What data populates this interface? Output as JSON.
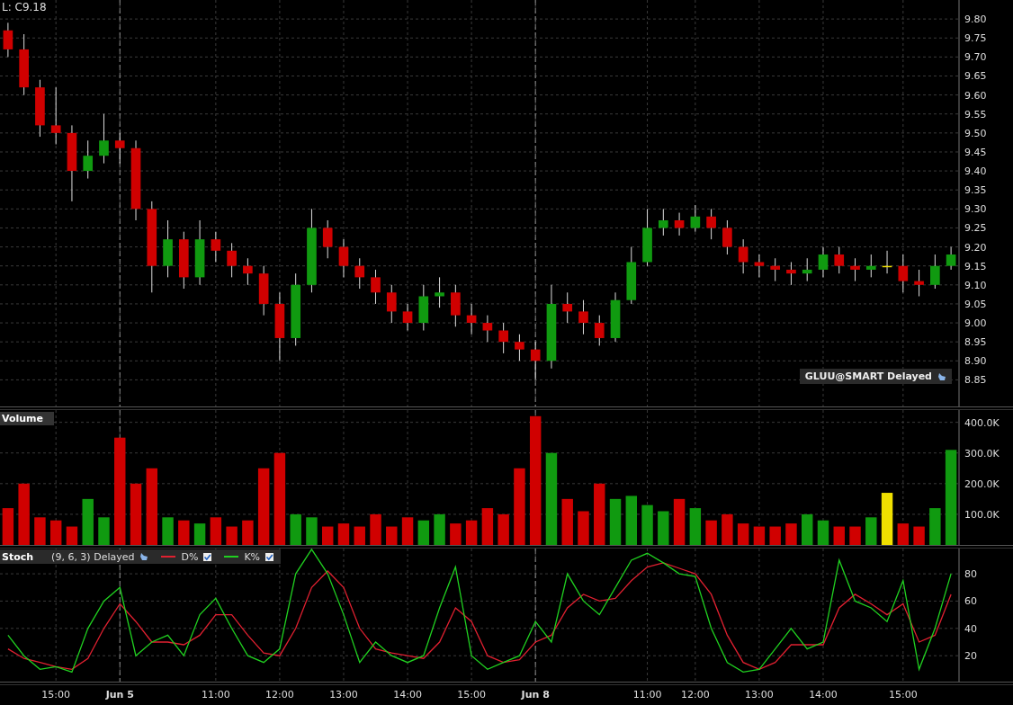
{
  "quote_label": "L: C9.18",
  "price_panel": {
    "badge": "GLUU@SMART Delayed",
    "chart_data": {
      "type": "candlestick",
      "grid": true,
      "ylim": [
        8.78,
        9.85
      ],
      "yticks": [
        {
          "value": 8.85,
          "label": "8.85"
        },
        {
          "value": 8.9,
          "label": "8.90"
        },
        {
          "value": 8.95,
          "label": "8.95"
        },
        {
          "value": 9.0,
          "label": "9.00"
        },
        {
          "value": 9.05,
          "label": "9.05"
        },
        {
          "value": 9.1,
          "label": "9.10"
        },
        {
          "value": 9.15,
          "label": "9.15"
        },
        {
          "value": 9.2,
          "label": "9.20"
        },
        {
          "value": 9.25,
          "label": "9.25"
        },
        {
          "value": 9.3,
          "label": "9.30"
        },
        {
          "value": 9.35,
          "label": "9.35"
        },
        {
          "value": 9.4,
          "label": "9.40"
        },
        {
          "value": 9.45,
          "label": "9.45"
        },
        {
          "value": 9.5,
          "label": "9.50"
        },
        {
          "value": 9.55,
          "label": "9.55"
        },
        {
          "value": 9.6,
          "label": "9.60"
        },
        {
          "value": 9.65,
          "label": "9.65"
        },
        {
          "value": 9.7,
          "label": "9.70"
        },
        {
          "value": 9.75,
          "label": "9.75"
        },
        {
          "value": 9.8,
          "label": "9.80"
        }
      ],
      "ohlc": [
        [
          9.77,
          9.79,
          9.7,
          9.72
        ],
        [
          9.72,
          9.76,
          9.6,
          9.62
        ],
        [
          9.62,
          9.64,
          9.49,
          9.52
        ],
        [
          9.52,
          9.62,
          9.47,
          9.5
        ],
        [
          9.5,
          9.52,
          9.32,
          9.4
        ],
        [
          9.4,
          9.48,
          9.38,
          9.44
        ],
        [
          9.44,
          9.55,
          9.42,
          9.48
        ],
        [
          9.48,
          9.5,
          9.42,
          9.46
        ],
        [
          9.46,
          9.48,
          9.27,
          9.3
        ],
        [
          9.3,
          9.32,
          9.08,
          9.15
        ],
        [
          9.15,
          9.27,
          9.12,
          9.22
        ],
        [
          9.22,
          9.24,
          9.09,
          9.12
        ],
        [
          9.12,
          9.27,
          9.1,
          9.22
        ],
        [
          9.22,
          9.24,
          9.16,
          9.19
        ],
        [
          9.19,
          9.21,
          9.12,
          9.15
        ],
        [
          9.15,
          9.17,
          9.1,
          9.13
        ],
        [
          9.13,
          9.15,
          9.02,
          9.05
        ],
        [
          9.05,
          9.08,
          8.9,
          8.96
        ],
        [
          8.96,
          9.13,
          8.94,
          9.1
        ],
        [
          9.1,
          9.3,
          9.08,
          9.25
        ],
        [
          9.25,
          9.27,
          9.17,
          9.2
        ],
        [
          9.2,
          9.22,
          9.12,
          9.15
        ],
        [
          9.15,
          9.17,
          9.09,
          9.12
        ],
        [
          9.12,
          9.14,
          9.05,
          9.08
        ],
        [
          9.08,
          9.1,
          9.0,
          9.03
        ],
        [
          9.03,
          9.05,
          8.98,
          9.0
        ],
        [
          9.0,
          9.1,
          8.98,
          9.07
        ],
        [
          9.07,
          9.12,
          9.04,
          9.08
        ],
        [
          9.08,
          9.1,
          8.99,
          9.02
        ],
        [
          9.02,
          9.05,
          8.97,
          9.0
        ],
        [
          9.0,
          9.02,
          8.95,
          8.98
        ],
        [
          8.98,
          9.0,
          8.92,
          8.95
        ],
        [
          8.95,
          8.97,
          8.9,
          8.93
        ],
        [
          8.93,
          8.95,
          8.85,
          8.9
        ],
        [
          8.9,
          9.1,
          8.88,
          9.05
        ],
        [
          9.05,
          9.08,
          9.0,
          9.03
        ],
        [
          9.03,
          9.06,
          8.97,
          9.0
        ],
        [
          9.0,
          9.02,
          8.94,
          8.96
        ],
        [
          8.96,
          9.08,
          8.95,
          9.06
        ],
        [
          9.06,
          9.2,
          9.05,
          9.16
        ],
        [
          9.16,
          9.3,
          9.15,
          9.25
        ],
        [
          9.25,
          9.3,
          9.23,
          9.27
        ],
        [
          9.27,
          9.29,
          9.23,
          9.25
        ],
        [
          9.25,
          9.31,
          9.24,
          9.28
        ],
        [
          9.28,
          9.3,
          9.22,
          9.25
        ],
        [
          9.25,
          9.27,
          9.18,
          9.2
        ],
        [
          9.2,
          9.22,
          9.13,
          9.16
        ],
        [
          9.16,
          9.18,
          9.12,
          9.15
        ],
        [
          9.15,
          9.17,
          9.11,
          9.14
        ],
        [
          9.14,
          9.16,
          9.1,
          9.13
        ],
        [
          9.13,
          9.17,
          9.11,
          9.14
        ],
        [
          9.14,
          9.2,
          9.12,
          9.18
        ],
        [
          9.18,
          9.2,
          9.13,
          9.15
        ],
        [
          9.15,
          9.17,
          9.11,
          9.14
        ],
        [
          9.14,
          9.18,
          9.12,
          9.15
        ],
        [
          9.15,
          9.19,
          9.13,
          9.15
        ],
        [
          9.15,
          9.18,
          9.08,
          9.11
        ],
        [
          9.11,
          9.14,
          9.07,
          9.1
        ],
        [
          9.1,
          9.18,
          9.09,
          9.15
        ],
        [
          9.15,
          9.2,
          9.14,
          9.18
        ]
      ]
    }
  },
  "volume_panel": {
    "chart_data": {
      "type": "bar",
      "grid": true,
      "ylim": [
        0,
        440000
      ],
      "yticks": [
        {
          "value": 100000,
          "label": "100.0K"
        },
        {
          "value": 200000,
          "label": "200.0K"
        },
        {
          "value": 300000,
          "label": "300.0K"
        },
        {
          "value": 400000,
          "label": "400.0K"
        }
      ],
      "series": [
        {
          "name": "Volume",
          "values": [
            120000,
            200000,
            90000,
            80000,
            60000,
            150000,
            90000,
            350000,
            200000,
            250000,
            90000,
            80000,
            70000,
            90000,
            60000,
            80000,
            250000,
            300000,
            100000,
            90000,
            60000,
            70000,
            60000,
            100000,
            60000,
            90000,
            80000,
            100000,
            70000,
            80000,
            120000,
            100000,
            250000,
            420000,
            300000,
            150000,
            110000,
            200000,
            150000,
            160000,
            130000,
            110000,
            150000,
            120000,
            80000,
            100000,
            70000,
            60000,
            60000,
            70000,
            100000,
            80000,
            60000,
            60000,
            90000,
            170000,
            70000,
            60000,
            120000,
            310000
          ]
        }
      ]
    }
  },
  "stoch_panel": {
    "title": "Stoch",
    "params": "(9, 6, 3) Delayed",
    "series_toggles": [
      {
        "checked": true
      },
      {
        "checked": true
      }
    ],
    "chart_data": {
      "type": "line",
      "grid": true,
      "legend": "top-left",
      "ylim": [
        1,
        98.5
      ],
      "categories": [
        null,
        null,
        null,
        "15:00",
        null,
        null,
        null,
        "Jun 5",
        null,
        null,
        null,
        null,
        null,
        "11:00",
        null,
        null,
        null,
        "12:00",
        null,
        null,
        null,
        "13:00",
        null,
        null,
        null,
        "14:00",
        null,
        null,
        null,
        "15:00",
        null,
        null,
        null,
        "Jun 8",
        null,
        null,
        null,
        null,
        null,
        null,
        "11:00",
        null,
        null,
        "12:00",
        null,
        null,
        null,
        "13:00",
        null,
        null,
        null,
        "14:00",
        null,
        null,
        null,
        null,
        "15:00",
        null,
        null,
        null
      ],
      "yticks": [
        {
          "value": 20,
          "label": "20"
        },
        {
          "value": 40,
          "label": "40"
        },
        {
          "value": 60,
          "label": "60"
        },
        {
          "value": 80,
          "label": "80"
        }
      ],
      "series": [
        {
          "name": "D%",
          "color": "#e02030",
          "values": [
            25,
            18,
            15,
            12,
            10,
            18,
            40,
            58,
            45,
            30,
            30,
            28,
            35,
            50,
            50,
            35,
            22,
            20,
            40,
            70,
            82,
            70,
            40,
            25,
            22,
            20,
            18,
            30,
            55,
            45,
            20,
            15,
            17,
            30,
            35,
            55,
            65,
            60,
            62,
            75,
            85,
            88,
            84,
            80,
            65,
            35,
            15,
            10,
            15,
            28,
            28,
            28,
            55,
            65,
            58,
            50,
            58,
            30,
            35,
            65
          ]
        },
        {
          "name": "K%",
          "color": "#20d020",
          "values": [
            35,
            20,
            10,
            12,
            8,
            40,
            60,
            70,
            20,
            30,
            35,
            20,
            50,
            62,
            40,
            20,
            15,
            25,
            80,
            98,
            80,
            50,
            15,
            30,
            20,
            15,
            20,
            55,
            85,
            20,
            10,
            15,
            20,
            45,
            30,
            80,
            60,
            50,
            70,
            90,
            95,
            88,
            80,
            78,
            40,
            15,
            8,
            10,
            25,
            40,
            25,
            30,
            90,
            60,
            55,
            45,
            75,
            10,
            40,
            80
          ]
        }
      ]
    }
  },
  "x_axis": [
    {
      "kind": "time"
    },
    {
      "kind": "day"
    },
    {
      "kind": "time"
    },
    {
      "kind": "time"
    },
    {
      "kind": "time"
    },
    {
      "kind": "time"
    },
    {
      "kind": "time"
    },
    {
      "kind": "day"
    },
    {
      "kind": "time"
    },
    {
      "kind": "time"
    },
    {
      "kind": "time"
    },
    {
      "kind": "time"
    },
    {
      "kind": "time"
    }
  ]
}
